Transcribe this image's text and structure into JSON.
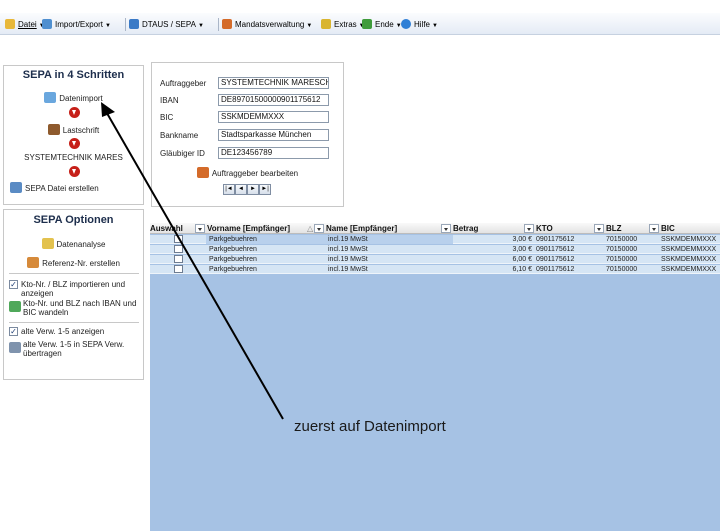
{
  "menubar": {
    "items": [
      {
        "label": "Datei",
        "icon": "folder-icon",
        "color": "#e8b83a"
      },
      {
        "label": "Import/Export",
        "icon": "import-export-icon",
        "color": "#4f8fd0"
      },
      {
        "label": "DTAUS / SEPA",
        "icon": "dtaus-sepa-icon",
        "color": "#3a7ac7"
      },
      {
        "label": "Mandatsverwaltung",
        "icon": "users-icon",
        "color": "#d46b2a"
      },
      {
        "label": "Extras",
        "icon": "wand-icon",
        "color": "#d9b530"
      },
      {
        "label": "Ende",
        "icon": "exit-icon",
        "color": "#3f9b3b"
      },
      {
        "label": "Hilfe",
        "icon": "help-icon",
        "color": "#2f7fd6"
      }
    ]
  },
  "schritte": {
    "title": "SEPA in 4 Schritten",
    "datenimport": "Datenimport",
    "lastschrift": "Lastschrift",
    "company": "SYSTEMTECHNIK MARES",
    "dateierstellen": "SEPA Datei erstellen"
  },
  "optionen": {
    "title": "SEPA Optionen",
    "datenanalyse": "Datenanalyse",
    "referenz": "Referenz-Nr. erstellen",
    "kto_import": "Kto-Nr. / BLZ importieren und anzeigen",
    "kto_wandeln": "Kto-Nr. und BLZ nach IBAN und BIC wandeln",
    "alte_anzeigen": "alte Verw. 1-5 anzeigen",
    "alte_uebertragen": "alte Verw. 1-5 in SEPA Verw. übertragen"
  },
  "auftraggeber": {
    "labels": {
      "auftraggeber": "Auftraggeber",
      "iban": "IBAN",
      "bic": "BIC",
      "bankname": "Bankname",
      "glaeubiger": "Gläubiger ID"
    },
    "values": {
      "auftraggeber": "SYSTEMTECHNIK MARESCH",
      "iban": "DE89701500000901175612",
      "bic": "SSKMDEMMXXX",
      "bankname": "Stadtsparkasse München",
      "glaeubiger": "DE123456789"
    },
    "edit_label": "Auftraggeber bearbeiten",
    "nav": [
      "|◄",
      "◄",
      "►",
      "►|"
    ]
  },
  "grid": {
    "headers": {
      "auswahl": "Auswahl",
      "vorname": "Vorname [Empfänger]",
      "name": "Name [Empfänger]",
      "betrag": "Betrag",
      "kto": "KTO",
      "blz": "BLZ",
      "bic": "BIC"
    },
    "rows": [
      {
        "vorname": "Parkgebuehren",
        "name": "incl.19 MwSt",
        "betrag": "3,00 €",
        "kto": "0901175612",
        "blz": "70150000",
        "bic": "SSKMDEMMXXX"
      },
      {
        "vorname": "Parkgebuehren",
        "name": "incl.19 MwSt",
        "betrag": "3,00 €",
        "kto": "0901175612",
        "blz": "70150000",
        "bic": "SSKMDEMMXXX"
      },
      {
        "vorname": "Parkgebuehren",
        "name": "incl.19 MwSt",
        "betrag": "6,00 €",
        "kto": "0901175612",
        "blz": "70150000",
        "bic": "SSKMDEMMXXX"
      },
      {
        "vorname": "Parkgebuehren",
        "name": "incl.19 MwSt",
        "betrag": "6,10 €",
        "kto": "0901175612",
        "blz": "70150000",
        "bic": "SSKMDEMMXXX"
      }
    ]
  },
  "annotation": {
    "text": "zuerst auf Datenimport",
    "arrow_color": "#000000"
  }
}
